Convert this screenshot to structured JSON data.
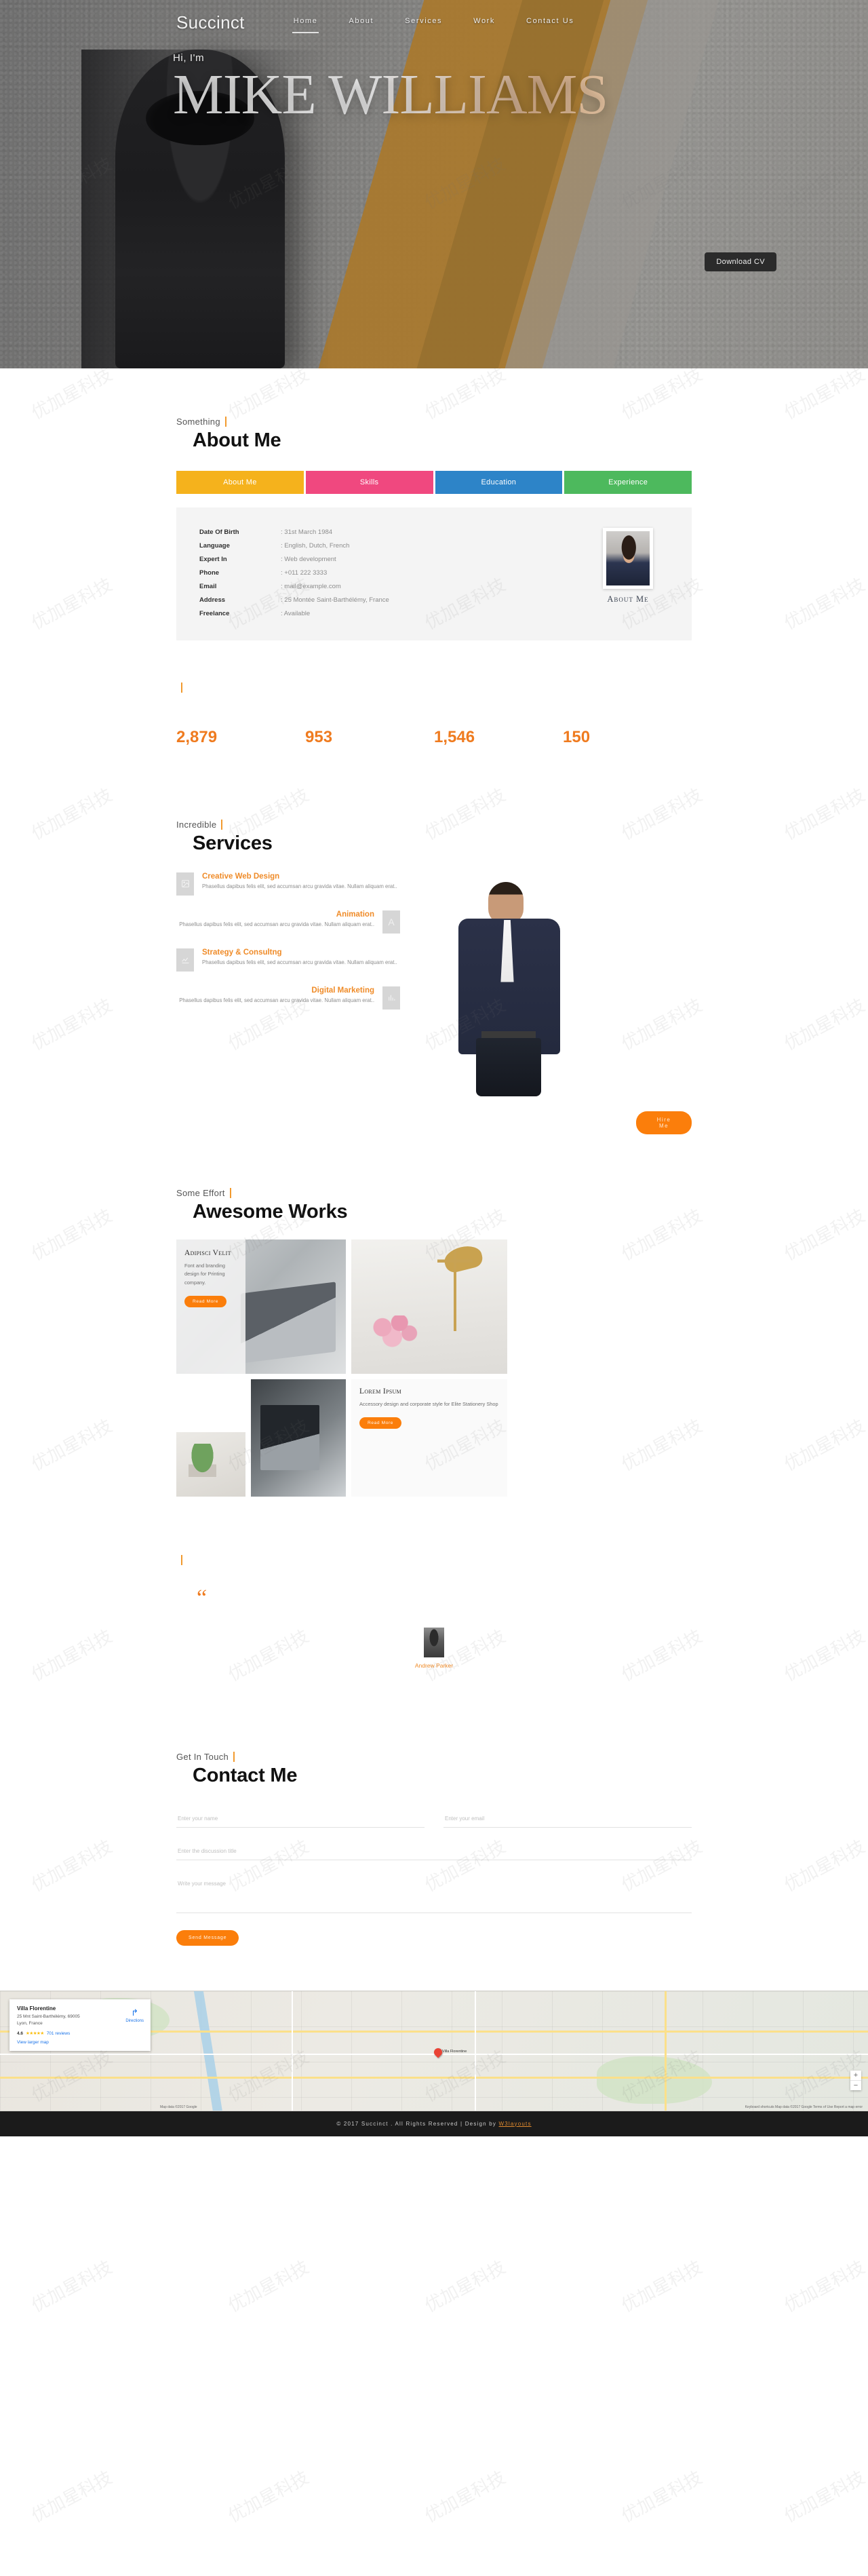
{
  "brand": "Succinct",
  "nav": {
    "items": [
      {
        "label": "Home",
        "active": true
      },
      {
        "label": "About",
        "active": false
      },
      {
        "label": "Services",
        "active": false
      },
      {
        "label": "Work",
        "active": false
      },
      {
        "label": "Contact Us",
        "active": false
      }
    ]
  },
  "hero": {
    "greeting": "Hi, I'm",
    "name": "MIKE WILLIAMS",
    "cta": "Download CV"
  },
  "about": {
    "subtitle": "Something",
    "title": "About Me",
    "tabs": [
      {
        "label": "About Me",
        "color": "#f5b21c"
      },
      {
        "label": "Skills",
        "color": "#f0487f"
      },
      {
        "label": "Education",
        "color": "#2d84c8"
      },
      {
        "label": "Experience",
        "color": "#4db95d"
      }
    ],
    "info": [
      {
        "label": "Date Of Birth",
        "value": "31st March 1984"
      },
      {
        "label": "Language",
        "value": "English, Dutch, French"
      },
      {
        "label": "Expert In",
        "value": "Web development"
      },
      {
        "label": "Phone",
        "value": "+011 222 3333"
      },
      {
        "label": "Email",
        "value": "mail@example.com"
      },
      {
        "label": "Address",
        "value": "25 Montée Saint-Barthélémy, France"
      },
      {
        "label": "Freelance",
        "value": "Available"
      }
    ],
    "photo_caption": "About Me"
  },
  "counters": {
    "subtitle": "",
    "title": "",
    "items": [
      {
        "value": "2,879",
        "label": ""
      },
      {
        "value": "953",
        "label": ""
      },
      {
        "value": "1,546",
        "label": ""
      },
      {
        "value": "150",
        "label": ""
      }
    ]
  },
  "services": {
    "subtitle": "Incredible",
    "title": "Services",
    "items": [
      {
        "title": "Creative Web Design",
        "desc": "Phasellus dapibus felis elit, sed accumsan arcu gravida vitae. Nullam aliquam erat..",
        "icon": "image-icon",
        "glyph": "Ὓc",
        "align": "left"
      },
      {
        "title": "Animation",
        "desc": "Phasellus dapibus felis elit, sed accumsan arcu gravida vitae. Nullam aliquam erat..",
        "icon": "letter-a-icon",
        "glyph": "A",
        "align": "right"
      },
      {
        "title": "Strategy & Consultng",
        "desc": "Phasellus dapibus felis elit, sed accumsan arcu gravida vitae. Nullam aliquam erat..",
        "icon": "line-chart-icon",
        "glyph": "↗",
        "align": "left"
      },
      {
        "title": "Digital Marketing",
        "desc": "Phasellus dapibus felis elit, sed accumsan arcu gravida vitae. Nullam aliquam erat..",
        "icon": "bar-chart-icon",
        "glyph": "▐",
        "align": "right"
      }
    ],
    "hire_label": "Hire Me"
  },
  "works": {
    "subtitle": "Some Effort",
    "title": "Awesome Works",
    "cards": [
      {
        "title": "Adipisci Velit",
        "desc": "Font and branding design for Printing company.",
        "cta": "Read More"
      },
      {
        "title": "Lorem Ipsum",
        "desc": "Accessory design and corporate style for Elite Stationery Shop",
        "cta": "Read More"
      }
    ]
  },
  "testimonial": {
    "subtitle": "",
    "title": "",
    "quote_glyph": "“",
    "quote": "",
    "name": "Andrew Parker",
    "role": ""
  },
  "contact": {
    "subtitle": "Get In Touch",
    "title": "Contact Me",
    "name_placeholder": "Enter your name",
    "email_placeholder": "Enter your email",
    "subject_placeholder": "Enter the discussion title",
    "message_placeholder": "Write your message",
    "submit_label": "Send Message"
  },
  "map": {
    "place": "Villa Florentine",
    "address_line1": "25 Mnt Saint-Barthélémy, 69005",
    "address_line2": "Lyon, France",
    "rating": "4.6",
    "stars": "★★★★★",
    "reviews": "701 reviews",
    "larger_map": "View larger map",
    "directions": "Directions",
    "pin_label": "Villa Florentine",
    "zoom_in": "+",
    "zoom_out": "−",
    "attribution": "Map data ©2017 Google",
    "footer_links": "Keyboard shortcuts   Map data ©2017 Google   Terms of Use   Report a map error"
  },
  "footer": {
    "text": "© 2017 Succinct . All Rights Reserved | Design by ",
    "link": "W3layouts"
  },
  "watermark": "优加星科技"
}
